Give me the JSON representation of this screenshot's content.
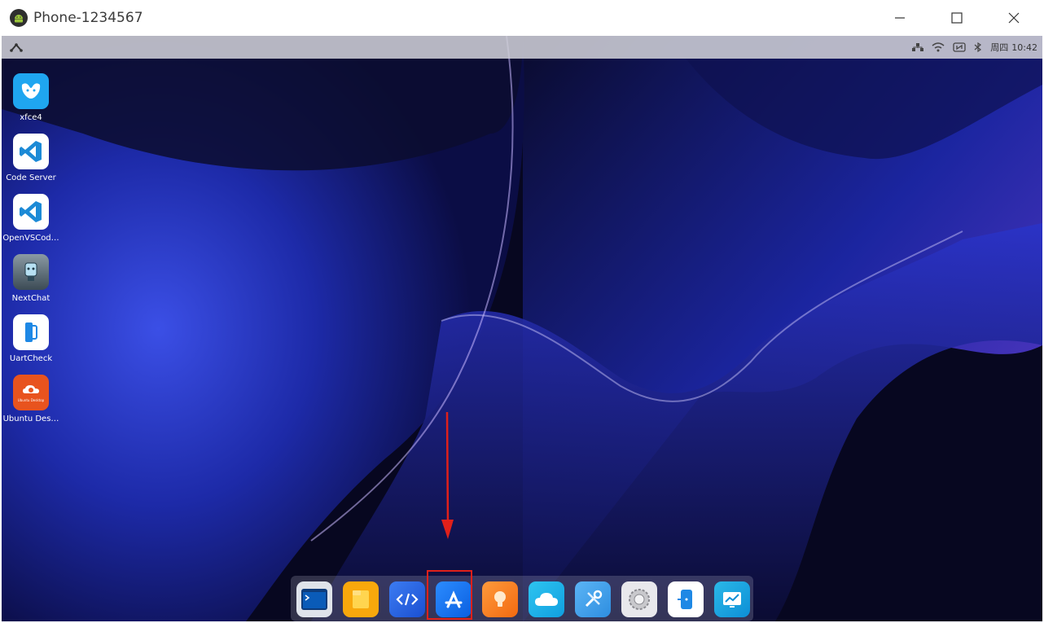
{
  "window": {
    "title": "Phone-1234567",
    "app_icon": "android-icon",
    "controls": [
      "minimize-icon",
      "maximize-icon",
      "close-icon"
    ]
  },
  "statusbar": {
    "left_icon": "launcher-icon",
    "icons": [
      "network-icon",
      "wifi-icon",
      "nfc-icon",
      "bluetooth-icon"
    ],
    "day": "周四",
    "time": "10:42"
  },
  "desktop_icons": [
    {
      "label": "xfce4",
      "icon": "xfce-mouse-icon",
      "color": "#1fa6f0"
    },
    {
      "label": "Code Server",
      "icon": "vscode-icon",
      "color": "#ffffff"
    },
    {
      "label": "OpenVSCod…",
      "icon": "vscode-icon",
      "color": "#ffffff"
    },
    {
      "label": "NextChat",
      "icon": "nextchat-icon",
      "color": "#5a6b75"
    },
    {
      "label": "UartCheck",
      "icon": "uartcheck-icon",
      "color": "#ffffff"
    },
    {
      "label": "Ubuntu Des…",
      "icon": "ubuntu-desktop-icon",
      "color": "#e8531e",
      "badge_text": "Ubuntu Desktop"
    }
  ],
  "dock": [
    {
      "name": "terminal",
      "icon": "terminal-icon"
    },
    {
      "name": "files",
      "icon": "folder-icon"
    },
    {
      "name": "code-editor",
      "icon": "code-icon"
    },
    {
      "name": "app-store",
      "icon": "app-store-icon",
      "highlighted": true
    },
    {
      "name": "tips",
      "icon": "lightbulb-icon"
    },
    {
      "name": "cloud",
      "icon": "cloud-icon"
    },
    {
      "name": "tools",
      "icon": "tools-icon"
    },
    {
      "name": "settings",
      "icon": "settings-gear-icon"
    },
    {
      "name": "phone-tool",
      "icon": "phone-tool-icon"
    },
    {
      "name": "system-monitor",
      "icon": "monitor-chart-icon"
    }
  ],
  "annotation": {
    "arrow_color": "#e0201a",
    "box_color": "#e0201a"
  }
}
